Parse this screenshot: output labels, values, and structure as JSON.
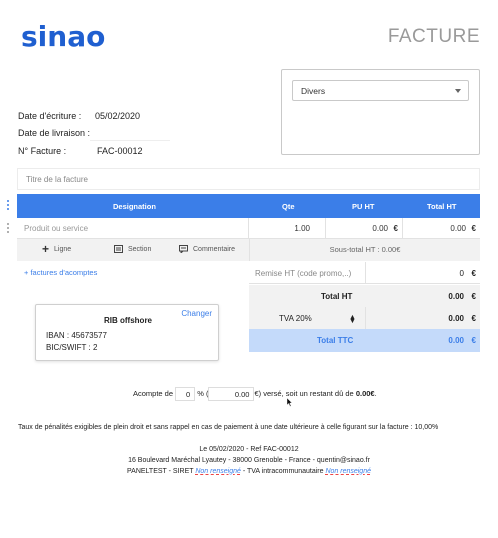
{
  "brand": {
    "name": "sinao",
    "color": "#1f5fd0"
  },
  "document": {
    "title": "FACTURE"
  },
  "client": {
    "selected": "Divers"
  },
  "meta": {
    "date_ecriture_label": "Date d'écriture :",
    "date_ecriture_value": "05/02/2020",
    "date_livraison_label": "Date de livraison :",
    "numero_label": "N° Facture :",
    "numero_value": "FAC-00012"
  },
  "invoice_title_placeholder": "Titre de la facture",
  "table": {
    "headers": {
      "designation": "Designation",
      "qte": "Qte",
      "pu_ht": "PU HT",
      "total_ht": "Total HT"
    },
    "row": {
      "product_placeholder": "Produit ou service",
      "qte": "1.00",
      "pu_ht": "0.00",
      "total_ht": "0.00",
      "currency": "€"
    }
  },
  "actions": {
    "ligne": "Ligne",
    "section": "Section",
    "commentaire": "Commentaire"
  },
  "subtotal": "Sous-total HT : 0.00€",
  "acomptes_link": "+ factures d'acomptes",
  "totals": {
    "remise_label": "Remise HT (code promo,..)",
    "remise_value": "0",
    "total_ht_label": "Total HT",
    "total_ht_value": "0.00",
    "tva_label": "TVA 20%",
    "tva_value": "0.00",
    "total_ttc_label": "Total TTC",
    "total_ttc_value": "0.00",
    "currency": "€"
  },
  "rib": {
    "title": "RIB offshore",
    "change_label": "Changer",
    "iban": "IBAN : 45673577",
    "bic": "BIC/SWIFT : 2"
  },
  "acompte": {
    "prefix": "Acompte de",
    "percent": "0",
    "percent_sign": "%",
    "open": "(",
    "amount": "0.00",
    "suffix": "€) versé, soit un restant dû de",
    "remaining": "0.00€",
    "end": "."
  },
  "penalty_text": "Taux de pénalités exigibles de plein droit et sans rappel en cas de paiement à une date ultérieure à celle figurant sur la facture : 10,00%",
  "footer": {
    "line1": "Le 05/02/2020 - Ref FAC-00012",
    "line2": "16 Boulevard Maréchal Lyautey - 38000 Grenoble - France - quentin@sinao.fr",
    "company": "PANELTEST",
    "siret_label": " - SIRET ",
    "not_set": "Non renseigné",
    "tva_label": " - TVA intracommunautaire "
  },
  "colors": {
    "accent": "#3b7ee8",
    "ttc_bg": "#c4dafa",
    "grey_bg": "#f2f2f2"
  }
}
